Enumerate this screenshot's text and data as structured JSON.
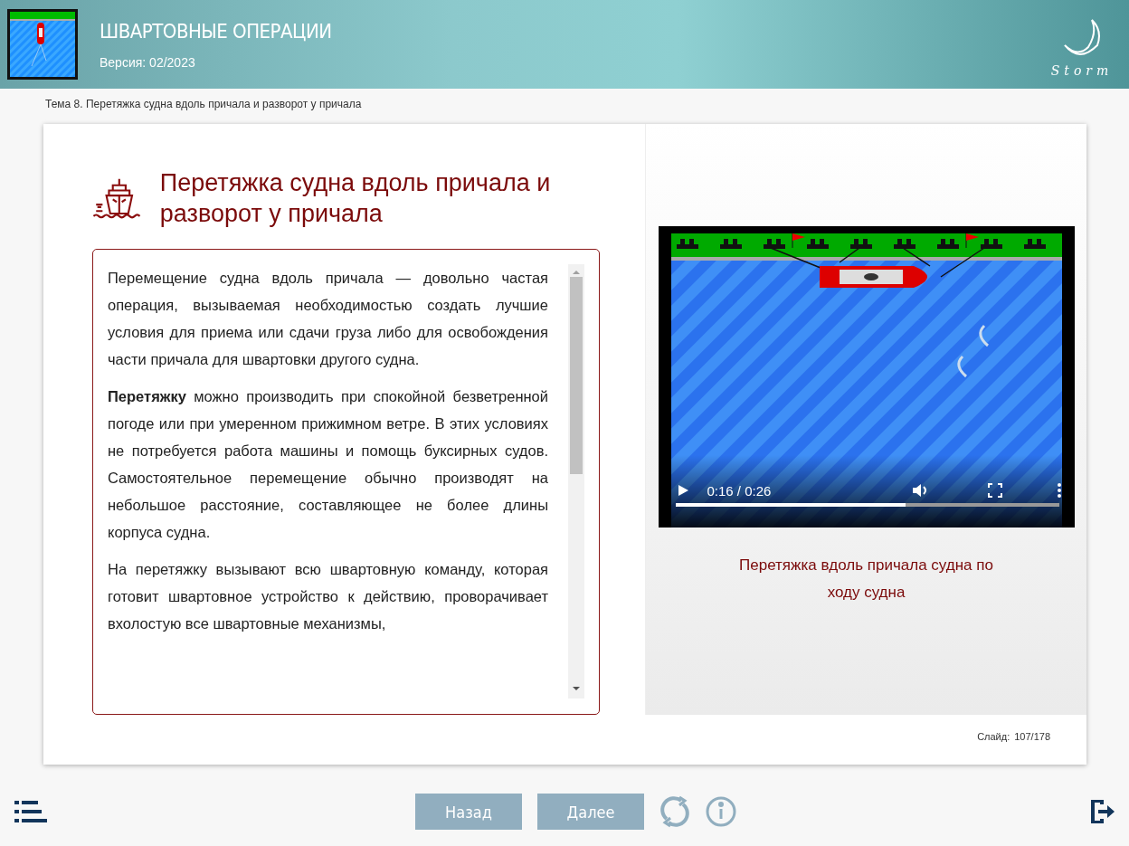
{
  "header": {
    "title": "ШВАРТОВНЫЕ ОПЕРАЦИИ",
    "version": "Версия: 02/2023",
    "logo_text": "Storm"
  },
  "breadcrumb": "Тема 8. Перетяжка судна вдоль причала и разворот у причала",
  "lesson": {
    "heading": "Перетяжка судна вдоль причала и разворот у причала",
    "paragraphs": [
      "Перемещение судна вдоль причала — довольно частая операция, вызываемая необходимостью создать лучшие условия для приема или сдачи груза либо для освобождения части причала для швартовки другого судна.",
      "**Перетяжку** можно производить при спокойной безветренной погоде или при умеренном прижимном ветре. В этих условиях не потребуется работа машины и помощь буксирных судов. Самостоятельное перемещение обычно производят на небольшое расстояние, составляющее не более длины корпуса судна.",
      "На перетяжку вызывают всю швартовную команду, которая готовит швартовное устройство к действию, проворачивает вхолостую все швартовные механизмы,"
    ]
  },
  "video": {
    "time": "0:16 / 0:26",
    "level": 0.6,
    "caption": "Перетяжка вдоль причала судна по ходу судна"
  },
  "slide_counter": {
    "label": "Слайд:",
    "value": "107/178"
  },
  "nav_buttons": [
    "Назад",
    "Далее"
  ]
}
